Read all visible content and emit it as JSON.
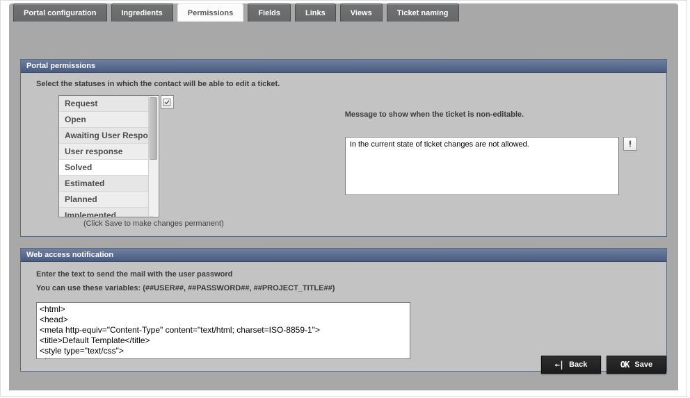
{
  "tabs": [
    {
      "label": "Portal configuration",
      "active": false
    },
    {
      "label": "Ingredients",
      "active": false
    },
    {
      "label": "Permissions",
      "active": true
    },
    {
      "label": "Fields",
      "active": false
    },
    {
      "label": "Links",
      "active": false
    },
    {
      "label": "Views",
      "active": false
    },
    {
      "label": "Ticket naming",
      "active": false
    }
  ],
  "permissions_panel": {
    "title": "Portal permissions",
    "instruction": "Select the statuses in which the contact will be able to edit a ticket.",
    "statuses": [
      {
        "label": "Request",
        "selected": false
      },
      {
        "label": "Open",
        "selected": false
      },
      {
        "label": "Awaiting User Respon",
        "selected": false
      },
      {
        "label": "User response",
        "selected": false
      },
      {
        "label": "Solved",
        "selected": true
      },
      {
        "label": "Estimated",
        "selected": false
      },
      {
        "label": "Planned",
        "selected": false
      },
      {
        "label": "Implemented",
        "selected": false
      }
    ],
    "save_hint": "(Click Save to make changes permanent)",
    "message_label": "Message to show when the ticket is non-editable.",
    "message_value": "In the current state of ticket changes are not allowed."
  },
  "notification_panel": {
    "title": "Web access notification",
    "line1": "Enter the text to send the mail with the user password",
    "line2": "You can use these variables: (##USER##, ##PASSWORD##, ##PROJECT_TITLE##)",
    "template_value": "<html>\n<head>\n<meta http-equiv=\"Content-Type\" content=\"text/html; charset=ISO-8859-1\">\n<title>Default Template</title>\n<style type=\"text/css\">\n<!--"
  },
  "buttons": {
    "back": "Back",
    "save": "Save"
  },
  "icons": {
    "select_all": "select-all-icon",
    "edit": "edit-icon",
    "back_arrow": "back-arrow-icon",
    "ok": "ok-icon"
  }
}
